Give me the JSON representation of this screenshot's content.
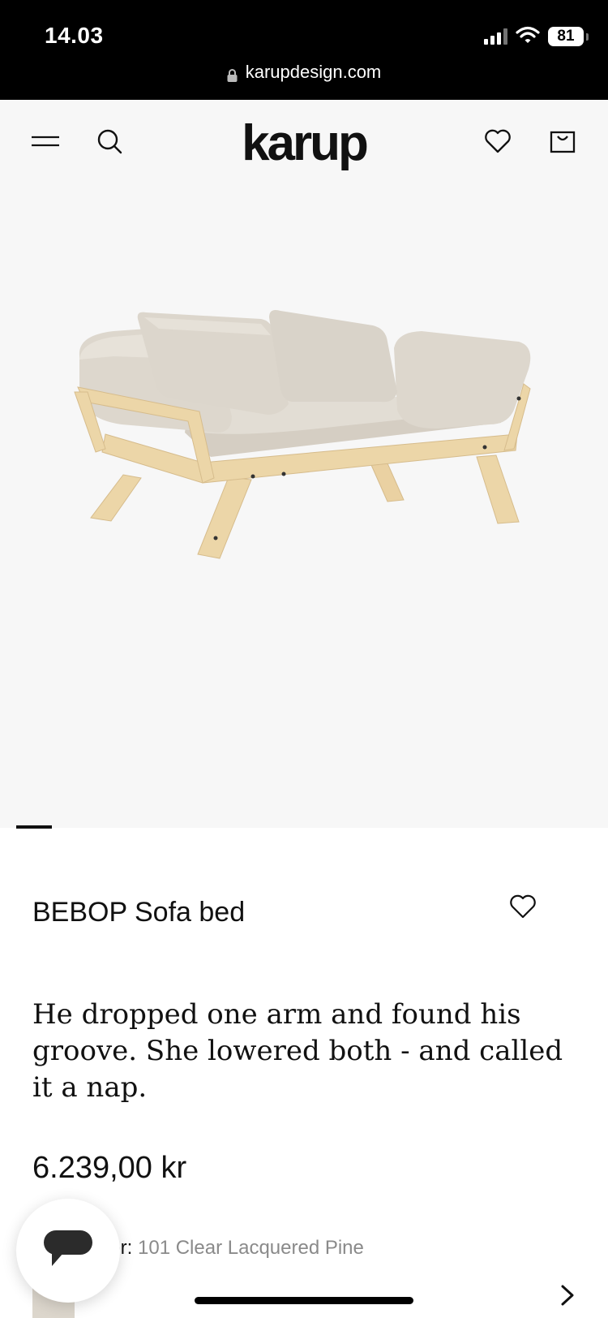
{
  "status_bar": {
    "time": "14.03",
    "battery": "81",
    "url": "karupdesign.com"
  },
  "header": {
    "logo": "karup",
    "icons": [
      "menu-icon",
      "search-icon",
      "heart-icon",
      "bag-icon"
    ]
  },
  "product": {
    "title": "BEBOP Sofa bed",
    "tagline": "He dropped one arm and found his groove. She lowered both - and called it a nap.",
    "price": "6.239,00 kr",
    "color_label": "lor:",
    "color_value": "101 Clear Lacquered Pine"
  },
  "colors": {
    "background": "#f7f7f7",
    "text": "#111111",
    "muted": "#8a8a8a",
    "cushion": "#d9d3c9",
    "wood": "#ecd6a8"
  }
}
